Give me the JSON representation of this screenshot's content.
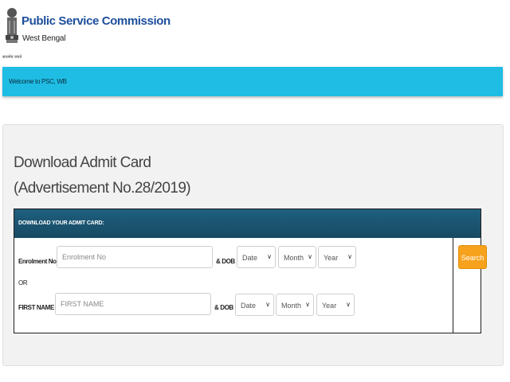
{
  "header": {
    "org_title": "Public Service Commission",
    "org_subtitle": "West Bengal",
    "emblem_caption": "सत्यमेव जयते"
  },
  "welcome": {
    "text": "Welcome to PSC, WB"
  },
  "page": {
    "title_line1": "Download Admit Card",
    "title_line2": "(Advertisement No.28/2019)"
  },
  "form": {
    "header": "DOWNLOAD YOUR ADMIT CARD:",
    "row1": {
      "label": "Enrolment No :",
      "placeholder": "Enrolment No",
      "dob_label": "& DOB :",
      "date": "Date",
      "month": "Month",
      "year": "Year"
    },
    "or_label": "OR",
    "row2": {
      "label": "FIRST NAME :",
      "placeholder": "FIRST NAME",
      "dob_label": "& DOB :",
      "date": "Date",
      "month": "Month",
      "year": "Year"
    },
    "search_label": "Search"
  },
  "colors": {
    "accent": "#1fbde4",
    "header_bar": "#174a63",
    "button": "#f7a21c",
    "title": "#1d4f9c"
  }
}
